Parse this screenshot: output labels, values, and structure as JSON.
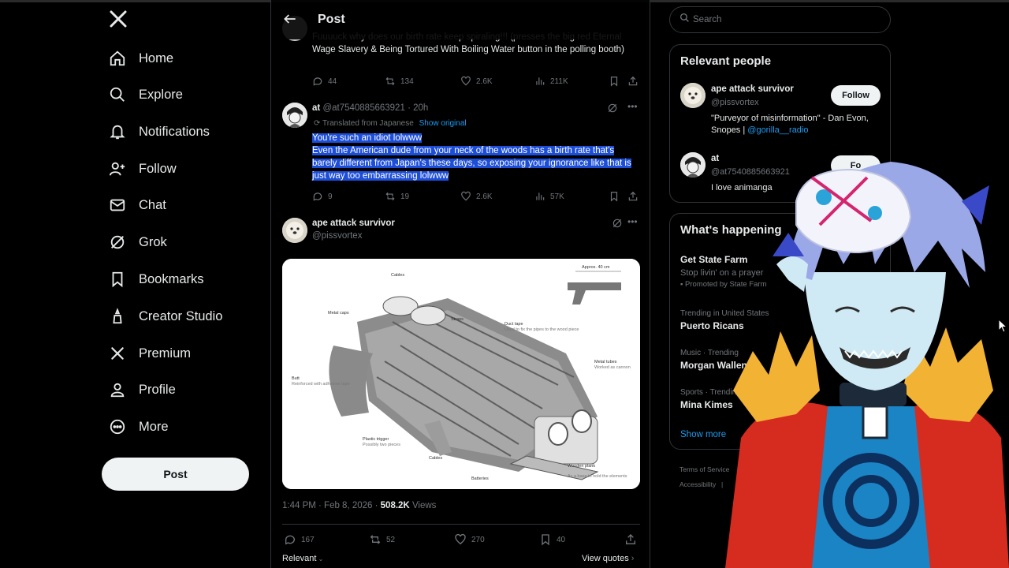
{
  "nav": {
    "items": [
      {
        "label": "Home",
        "icon": "home-icon"
      },
      {
        "label": "Explore",
        "icon": "search-icon"
      },
      {
        "label": "Notifications",
        "icon": "bell-icon"
      },
      {
        "label": "Follow",
        "icon": "add-person-icon"
      },
      {
        "label": "Chat",
        "icon": "envelope-icon"
      },
      {
        "label": "Grok",
        "icon": "grok-icon"
      },
      {
        "label": "Bookmarks",
        "icon": "bookmark-icon"
      },
      {
        "label": "Creator Studio",
        "icon": "creator-icon"
      },
      {
        "label": "Premium",
        "icon": "x-logo-icon"
      },
      {
        "label": "Profile",
        "icon": "person-icon"
      },
      {
        "label": "More",
        "icon": "more-circle-icon"
      }
    ],
    "post_label": "Post"
  },
  "header": {
    "title": "Post"
  },
  "thread": {
    "first_tweet": {
      "text": "Fuuuuck why does our birth rate keep spiraling!!! (presses the big red Eternal Wage Slavery & Being Tortured With Boiling Water button in the polling booth)",
      "replies": "44",
      "reposts": "134",
      "likes": "2.6K",
      "views": "211K"
    },
    "reply": {
      "name": "at",
      "handle": "@at7540885663921",
      "time": "20h",
      "translated_label": "Translated from Japanese",
      "show_original": "Show original",
      "line1": "You're such an idiot lolwww",
      "line2": "Even the American dude from your neck of the woods has a birth rate that's barely different from Japan's these days, so exposing your ignorance like that is just way too embarrassing lolwww",
      "replies": "9",
      "reposts": "19",
      "likes": "2.6K",
      "views": "57K"
    },
    "main": {
      "name": "ape attack survivor",
      "handle": "@pissvortex",
      "image_labels": {
        "approx": "Approx. 40 cm",
        "cables_top": "Cables",
        "metal_caps": "Metal caps",
        "straps": "Straps",
        "duct_tape": "Duct tape",
        "duct_tape_note": "Used to fix the pipes to the wood piece",
        "metal_tubes": "Metal tubes",
        "metal_tubes_note": "Worked as cannon",
        "butt": "Butt",
        "butt_note": "Reinforced with adhesive tape",
        "plastic_trigger": "Plastic trigger",
        "plastic_trigger_note": "Possibly two pieces",
        "cables_bottom": "Cables",
        "batteries": "Batteries",
        "wooden_plank": "Wooden plank",
        "wooden_plank_note": "As a base to hold the elements"
      },
      "timestamp": "1:44 PM · Feb 8, 2026 · ",
      "views_count": "508.2K",
      "views_label": "Views",
      "replies": "167",
      "reposts": "52",
      "likes": "270",
      "bookmarks": "40",
      "relevant_label": "Relevant",
      "view_quotes": "View quotes"
    }
  },
  "search": {
    "placeholder": "Search"
  },
  "relevant_people": {
    "title": "Relevant people",
    "people": [
      {
        "name": "ape attack survivor",
        "handle": "@pissvortex",
        "bio": "\"Purveyor of misinformation\" - Dan Evon, Snopes | ",
        "bio_link": "@gorilla__radio",
        "follow_label": "Follow"
      },
      {
        "name": "at",
        "handle": "@at7540885663921",
        "bio": "I love animanga",
        "follow_label": "Fo"
      }
    ]
  },
  "whats_happening": {
    "title": "What's happening",
    "promo": {
      "name": "Get State Farm",
      "tagline": "Stop livin' on a prayer",
      "promoted": "Promoted by State Farm"
    },
    "trends": [
      {
        "context": "Trending in United States",
        "name": "Puerto Ricans"
      },
      {
        "context": "Music · Trending",
        "name": "Morgan Wallen"
      },
      {
        "context": "Sports · Trending",
        "name": "Mina Kimes"
      }
    ],
    "show_more": "Show more"
  },
  "footer": {
    "terms": "Terms of Service",
    "accessibility": "Accessibility",
    "sep": "|"
  },
  "colors": {
    "accent": "#1d9bf0",
    "highlight": "#1d4ed8",
    "background": "#000000",
    "border": "#2f3336",
    "muted": "#71767b"
  }
}
